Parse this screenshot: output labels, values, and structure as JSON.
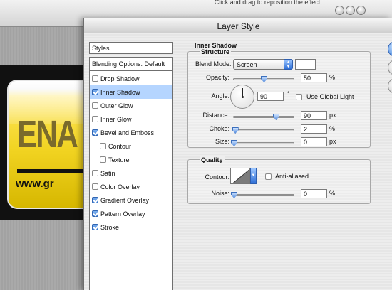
{
  "background_window": {
    "hint_text": "Click and drag to reposition the effect",
    "artwork_text": "ENA",
    "artwork_url": "www.gr"
  },
  "dialog": {
    "title": "Layer Style",
    "styles_header": "Styles",
    "blending_options": "Blending Options: Default",
    "style_items": [
      {
        "label": "Drop Shadow",
        "checked": false,
        "selected": false
      },
      {
        "label": "Inner Shadow",
        "checked": true,
        "selected": true
      },
      {
        "label": "Outer Glow",
        "checked": false,
        "selected": false
      },
      {
        "label": "Inner Glow",
        "checked": false,
        "selected": false
      },
      {
        "label": "Bevel and Emboss",
        "checked": true,
        "selected": false
      },
      {
        "label": "Contour",
        "checked": false,
        "selected": false
      },
      {
        "label": "Texture",
        "checked": false,
        "selected": false
      },
      {
        "label": "Satin",
        "checked": false,
        "selected": false
      },
      {
        "label": "Color Overlay",
        "checked": false,
        "selected": false
      },
      {
        "label": "Gradient Overlay",
        "checked": true,
        "selected": false
      },
      {
        "label": "Pattern Overlay",
        "checked": true,
        "selected": false
      },
      {
        "label": "Stroke",
        "checked": true,
        "selected": false
      }
    ],
    "panel_title": "Inner Shadow",
    "structure": {
      "title": "Structure",
      "blend_mode_label": "Blend Mode:",
      "blend_mode_value": "Screen",
      "shadow_color": "#ffffff",
      "opacity_label": "Opacity:",
      "opacity_value": "50",
      "opacity_unit": "%",
      "opacity_level_pct": 50,
      "angle_label": "Angle:",
      "angle_value": "90",
      "angle_unit": "°",
      "use_global_light_label": "Use Global Light",
      "use_global_light": false,
      "distance_label": "Distance:",
      "distance_value": "90",
      "distance_unit": "px",
      "distance_level_pct": 70,
      "choke_label": "Choke:",
      "choke_value": "2",
      "choke_unit": "%",
      "choke_level_pct": 2,
      "size_label": "Size:",
      "size_value": "0",
      "size_unit": "px",
      "size_level_pct": 0
    },
    "quality": {
      "title": "Quality",
      "contour_label": "Contour:",
      "anti_aliased_label": "Anti-aliased",
      "anti_aliased": false,
      "noise_label": "Noise:",
      "noise_value": "0",
      "noise_unit": "%",
      "noise_level_pct": 0
    }
  },
  "colors": {
    "selection": "#b5d5ff",
    "aqua_blue": "#3d82e0",
    "artwork_yellow": "#f1d321"
  }
}
